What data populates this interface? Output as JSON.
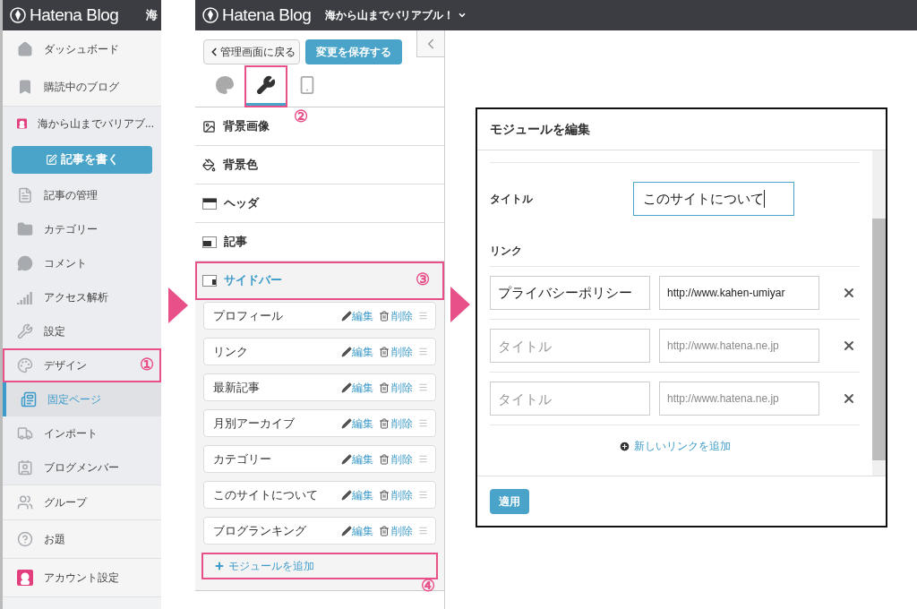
{
  "admin_sidebar": {
    "logo": "Hatena Blog",
    "blog_title": "海",
    "sections": [
      {
        "items": [
          {
            "kind": "home",
            "label": "ダッシュボード",
            "selected": false
          },
          {
            "kind": "bookmark",
            "label": "購読中のブログ",
            "selected": false
          }
        ]
      },
      {
        "items": [
          {
            "kind": "avatar",
            "label": "海から山までバリアブ...",
            "selected": false
          },
          {
            "kind": "write",
            "label": "記事を書く",
            "selected": false
          },
          {
            "kind": "document",
            "label": "記事の管理",
            "selected": false
          },
          {
            "kind": "folder",
            "label": "カテゴリー",
            "selected": false
          },
          {
            "kind": "comment",
            "label": "コメント",
            "selected": false
          },
          {
            "kind": "chart",
            "label": "アクセス解析",
            "selected": false
          },
          {
            "kind": "wrench",
            "label": "設定",
            "selected": false
          },
          {
            "kind": "palette",
            "label": "デザイン",
            "selected": false,
            "marker": "①"
          },
          {
            "kind": "page",
            "label": "固定ページ",
            "selected": true
          },
          {
            "kind": "truck",
            "label": "インポート",
            "selected": false
          },
          {
            "kind": "members",
            "label": "ブログメンバー",
            "selected": false
          }
        ]
      },
      {
        "items": [
          {
            "kind": "group",
            "label": "グループ",
            "selected": false
          }
        ]
      },
      {
        "items": [
          {
            "kind": "topic",
            "label": "お題",
            "selected": false
          }
        ]
      },
      {
        "items": [
          {
            "kind": "avatar",
            "label": "アカウント設定",
            "selected": false
          }
        ]
      }
    ]
  },
  "design_panel": {
    "logo": "Hatena Blog",
    "blog_title": "海から山までバリアブル！",
    "back_button": "管理画面に戻る",
    "save_button": "変更を保存する",
    "tabs": [
      {
        "kind": "palette",
        "selected": false
      },
      {
        "kind": "wrench",
        "selected": true,
        "marker": "②"
      },
      {
        "kind": "phone",
        "selected": false
      }
    ],
    "menu": [
      {
        "kind": "image",
        "label": "背景画像",
        "selected": false
      },
      {
        "kind": "fill",
        "label": "背景色",
        "selected": false
      },
      {
        "kind": "header",
        "label": "ヘッダ",
        "selected": false
      },
      {
        "kind": "article",
        "label": "記事",
        "selected": false
      },
      {
        "kind": "sidebar",
        "label": "サイドバー",
        "selected": true,
        "marker": "③"
      }
    ],
    "modules": [
      {
        "name": "プロフィール",
        "edit": "編集",
        "delete": "削除"
      },
      {
        "name": "リンク",
        "edit": "編集",
        "delete": "削除"
      },
      {
        "name": "最新記事",
        "edit": "編集",
        "delete": "削除"
      },
      {
        "name": "月別アーカイブ",
        "edit": "編集",
        "delete": "削除"
      },
      {
        "name": "カテゴリー",
        "edit": "編集",
        "delete": "削除"
      },
      {
        "name": "このサイトについて",
        "edit": "編集",
        "delete": "削除"
      },
      {
        "name": "ブログランキング",
        "edit": "編集",
        "delete": "削除"
      }
    ],
    "add_module": {
      "label": "モジュールを追加",
      "marker": "④"
    }
  },
  "modal": {
    "title": "モジュールを編集",
    "title_label": "タイトル",
    "title_value": "このサイトについて",
    "links_label": "リンク",
    "links": [
      {
        "title_value": "プライバシーポリシー",
        "url_value": "http://www.kahen-umiyar"
      },
      {
        "title_placeholder": "タイトル",
        "url_placeholder": "http://www.hatena.ne.jp"
      },
      {
        "title_placeholder": "タイトル",
        "url_placeholder": "http://www.hatena.ne.jp"
      }
    ],
    "add_link": "新しいリンクを追加",
    "apply_button": "適用"
  }
}
